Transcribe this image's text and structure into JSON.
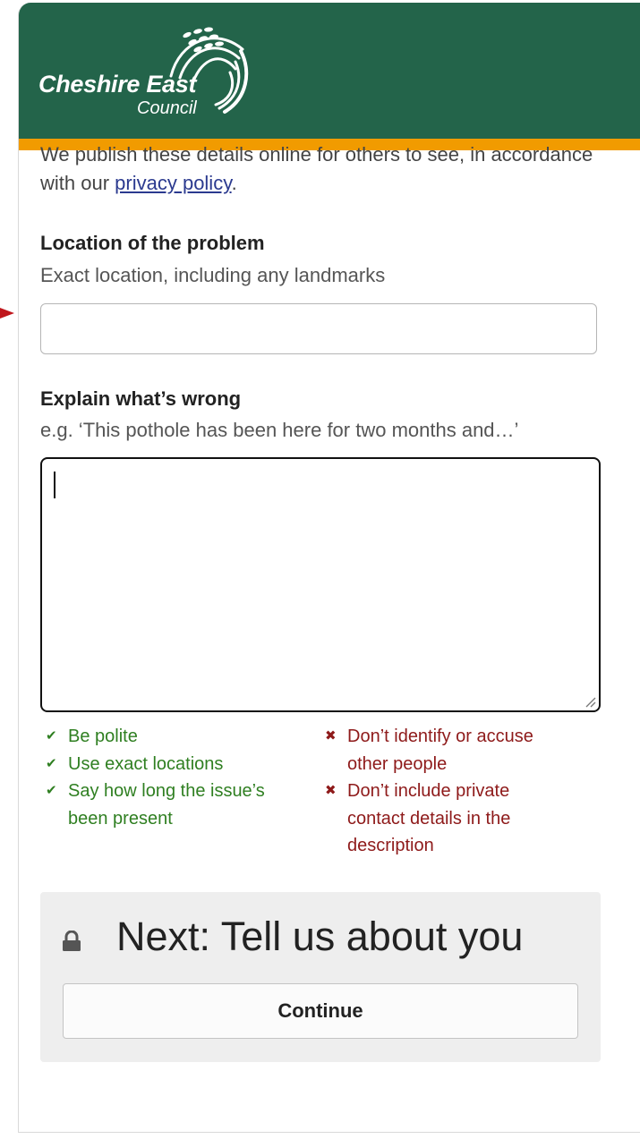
{
  "brand": {
    "name": "Cheshire East",
    "subname": "Council",
    "header_color": "#23644a",
    "stripe_color": "#f19b00"
  },
  "intro": {
    "text_before_link": "We publish these details online for others to see, in accordance with our ",
    "link_text": "privacy policy",
    "text_after_link": "."
  },
  "location_field": {
    "label": "Location of the problem",
    "hint": "Exact location, including any landmarks",
    "value": "",
    "placeholder": ""
  },
  "description_field": {
    "label": "Explain what’s wrong",
    "hint": "e.g. ‘This pothole has been here for two months and…’",
    "value": ""
  },
  "tips": {
    "do": [
      "Be polite",
      "Use exact locations",
      "Say how long the issue’s been present"
    ],
    "dont": [
      "Don’t identify or accuse other people",
      "Don’t include private contact details in the description"
    ],
    "do_color": "#2f7f21",
    "dont_color": "#8e1a1a"
  },
  "next_step": {
    "title": "Next: Tell us about you",
    "button_label": "Continue"
  },
  "icons": {
    "do_mark": "✔",
    "dont_mark": "✖",
    "lock": "lock-icon",
    "emblem": "wheat-sheaf-icon",
    "pointer": "arrow-right-icon"
  }
}
